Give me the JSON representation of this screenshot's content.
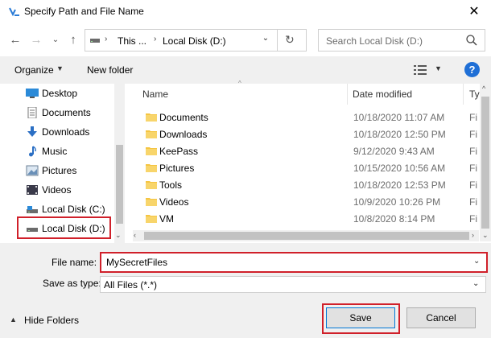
{
  "window": {
    "title": "Specify Path and File Name"
  },
  "address": {
    "crumb1": "This ...",
    "crumb2": "Local Disk (D:)"
  },
  "search": {
    "placeholder": "Search Local Disk (D:)"
  },
  "toolbar": {
    "organize_label": "Organize",
    "new_folder_label": "New folder"
  },
  "nav_pane": {
    "items": [
      {
        "label": "Desktop",
        "icon": "desktop-icon"
      },
      {
        "label": "Documents",
        "icon": "documents-icon"
      },
      {
        "label": "Downloads",
        "icon": "downloads-icon"
      },
      {
        "label": "Music",
        "icon": "music-icon"
      },
      {
        "label": "Pictures",
        "icon": "pictures-icon"
      },
      {
        "label": "Videos",
        "icon": "videos-icon"
      },
      {
        "label": "Local Disk (C:)",
        "icon": "drive-icon"
      },
      {
        "label": "Local Disk (D:)",
        "icon": "drive-icon",
        "selected": true
      }
    ]
  },
  "file_list": {
    "columns": [
      "Name",
      "Date modified",
      "Ty"
    ],
    "rows": [
      {
        "name": "Documents",
        "date": "10/18/2020 11:07 AM",
        "type": "Fi"
      },
      {
        "name": "Downloads",
        "date": "10/18/2020 12:50 PM",
        "type": "Fi"
      },
      {
        "name": "KeePass",
        "date": "9/12/2020 9:43 AM",
        "type": "Fi"
      },
      {
        "name": "Pictures",
        "date": "10/15/2020 10:56 AM",
        "type": "Fi"
      },
      {
        "name": "Tools",
        "date": "10/18/2020 12:53 PM",
        "type": "Fi"
      },
      {
        "name": "Videos",
        "date": "10/9/2020 10:26 PM",
        "type": "Fi"
      },
      {
        "name": "VM",
        "date": "10/8/2020 8:14 PM",
        "type": "Fi"
      }
    ]
  },
  "form": {
    "file_name_label": "File name:",
    "file_name_value": "MySecretFiles",
    "save_as_label": "Save as type:",
    "save_as_value": "All Files (*.*)"
  },
  "footer": {
    "hide_folders_label": "Hide Folders",
    "save_label": "Save",
    "cancel_label": "Cancel"
  },
  "colors": {
    "highlight": "#d0202a",
    "folder": "#f5c542",
    "accent": "#0078d7"
  }
}
